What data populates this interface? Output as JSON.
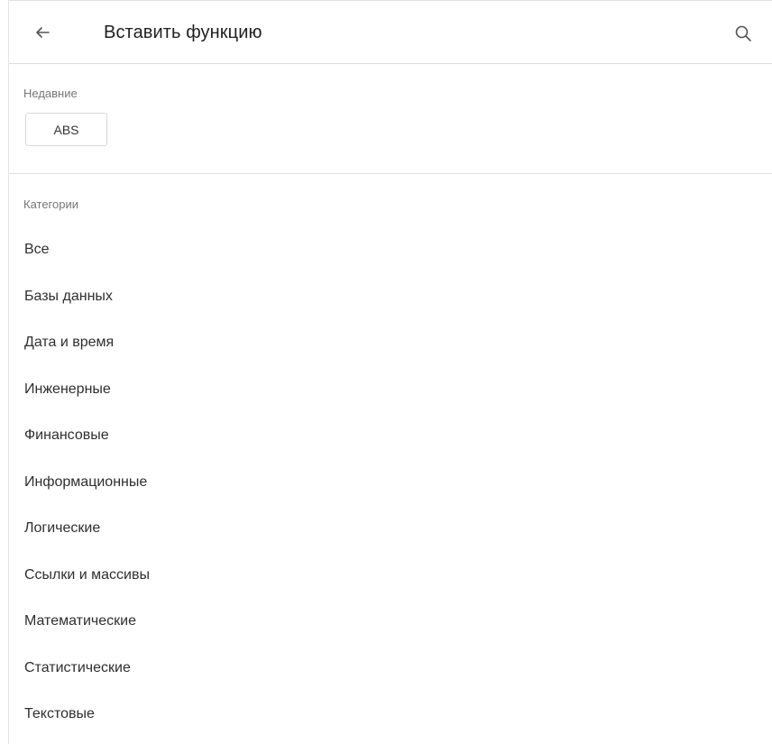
{
  "header": {
    "title": "Вставить функцию",
    "back_icon": "arrow-left-icon",
    "search_icon": "search-icon"
  },
  "recent": {
    "label": "Недавние",
    "items": [
      "ABS"
    ]
  },
  "categories": {
    "label": "Категории",
    "items": [
      "Все",
      "Базы данных",
      "Дата и время",
      "Инженерные",
      "Финансовые",
      "Информационные",
      "Логические",
      "Ссылки и массивы",
      "Математические",
      "Статистические",
      "Текстовые"
    ]
  }
}
